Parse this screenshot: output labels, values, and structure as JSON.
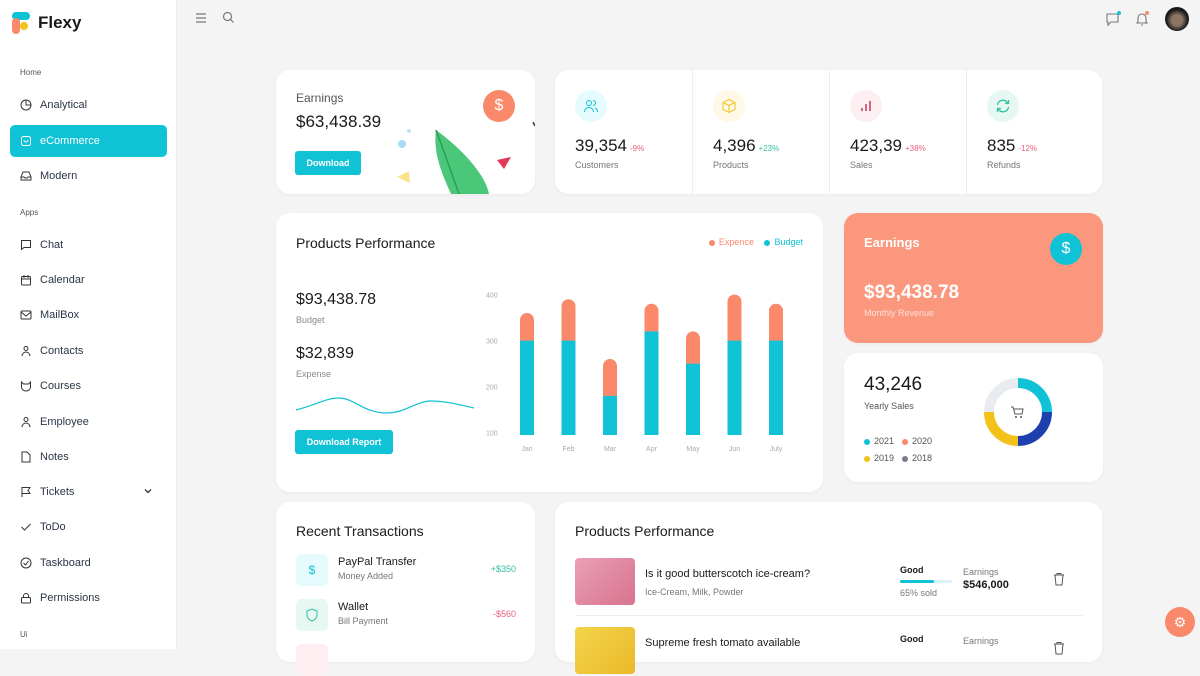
{
  "app": {
    "name": "Flexy"
  },
  "sidebar": {
    "sections": [
      {
        "caption": "Home"
      },
      {
        "caption": "Apps"
      },
      {
        "caption": "Ui"
      }
    ],
    "items": [
      {
        "label": "Analytical",
        "icon": "pie-chart-icon"
      },
      {
        "label": "eCommerce",
        "icon": "shopping-bag-icon",
        "active": true
      },
      {
        "label": "Modern",
        "icon": "inbox-icon"
      },
      {
        "label": "Chat",
        "icon": "message-icon"
      },
      {
        "label": "Calendar",
        "icon": "calendar-icon"
      },
      {
        "label": "MailBox",
        "icon": "mail-icon"
      },
      {
        "label": "Contacts",
        "icon": "user-icon"
      },
      {
        "label": "Courses",
        "icon": "courses-icon"
      },
      {
        "label": "Employee",
        "icon": "user-icon"
      },
      {
        "label": "Notes",
        "icon": "note-icon"
      },
      {
        "label": "Tickets",
        "icon": "flag-icon",
        "has_submenu": true
      },
      {
        "label": "ToDo",
        "icon": "check-icon"
      },
      {
        "label": "Taskboard",
        "icon": "check-circle-icon"
      },
      {
        "label": "Permissions",
        "icon": "lock-icon"
      }
    ]
  },
  "earnings_card": {
    "title": "Earnings",
    "value": "$63,438.39",
    "button": "Download"
  },
  "stats": [
    {
      "value": "39,354",
      "change": "-9%",
      "label": "Customers",
      "icon": "users-icon",
      "color": "#e6fbfd",
      "ic": "#10c2d5",
      "chg": "#e9617c"
    },
    {
      "value": "4,396",
      "change": "+23%",
      "label": "Products",
      "icon": "box-icon",
      "color": "#fff8e6",
      "ic": "#f2c21a",
      "chg": "#33c1a0"
    },
    {
      "value": "423,39",
      "change": "+38%",
      "label": "Sales",
      "icon": "bar-chart-icon",
      "color": "#fdeef2",
      "ic": "#c23a5e",
      "chg": "#e9617c"
    },
    {
      "value": "835",
      "change": "-12%",
      "label": "Refunds",
      "icon": "refresh-icon",
      "color": "#e6f8f1",
      "ic": "#33c1a0",
      "chg": "#e9617c"
    }
  ],
  "products_performance": {
    "title": "Products Performance",
    "budget_value": "$93,438.78",
    "budget_label": "Budget",
    "expense_value": "$32,839",
    "expense_label": "Expense",
    "button": "Download Report",
    "legend": [
      {
        "name": "Expence",
        "color": "#fa896b"
      },
      {
        "name": "Budget",
        "color": "#10c2d5"
      }
    ]
  },
  "chart_data": {
    "type": "bar",
    "stacked": true,
    "categories": [
      "Jan",
      "Feb",
      "Mar",
      "Apr",
      "May",
      "Jun",
      "July"
    ],
    "series": [
      {
        "name": "Budget",
        "values": [
          300,
          300,
          180,
          320,
          250,
          300,
          300
        ]
      },
      {
        "name": "Expence",
        "values": [
          60,
          90,
          80,
          60,
          70,
          100,
          80
        ]
      }
    ],
    "yticks": [
      100,
      200,
      300,
      400
    ],
    "ylim": [
      95,
      410
    ],
    "grid": false,
    "legend": "top-right"
  },
  "monthly_earnings": {
    "title": "Earnings",
    "value": "$93,438.78",
    "label": "Monthly Revenue"
  },
  "yearly_sales": {
    "value": "43,246",
    "label": "Yearly Sales",
    "legend": [
      {
        "year": "2021",
        "color": "#10c2d5"
      },
      {
        "year": "2020",
        "color": "#fa896b"
      },
      {
        "year": "2019",
        "color": "#f2c21a"
      },
      {
        "year": "2018",
        "color": "#777e89"
      }
    ],
    "donut": [
      {
        "name": "2021",
        "value": 25,
        "color": "#10c2d5"
      },
      {
        "name": "2020",
        "value": 25,
        "color": "#1e40af"
      },
      {
        "name": "2019",
        "value": 25,
        "color": "#f2c21a"
      },
      {
        "name": "2018",
        "value": 25,
        "color": "#e8ecf0"
      }
    ]
  },
  "transactions": {
    "title": "Recent Transactions",
    "items": [
      {
        "title": "PayPal Transfer",
        "sub": "Money Added",
        "amount": "+$350",
        "positive": true
      },
      {
        "title": "Wallet",
        "sub": "Bill Payment",
        "amount": "-$560",
        "positive": false
      }
    ]
  },
  "products_list": {
    "title": "Products Performance",
    "items": [
      {
        "title": "Is it good butterscotch ice-cream?",
        "sub": "Ice-Cream, Milk, Powder",
        "status": "Good",
        "progress": 65,
        "sold": "65% sold",
        "earn_label": "Earnings",
        "earn_value": "$546,000"
      },
      {
        "title": "Supreme fresh tomato available",
        "sub": "",
        "status": "Good",
        "earn_label": "Earnings"
      }
    ]
  }
}
